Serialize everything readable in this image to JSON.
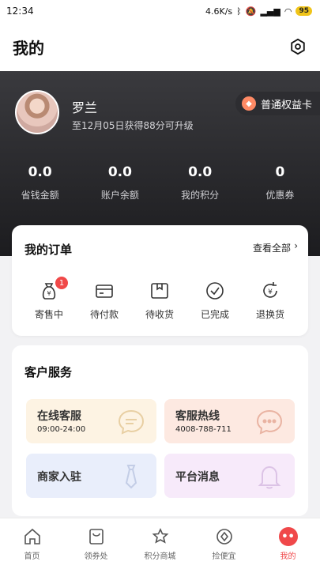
{
  "status_bar": {
    "time": "12:34",
    "network_speed": "4.6K/s",
    "signal_icons": [
      "bluetooth-icon",
      "mute-icon",
      "signal-icon",
      "wifi-icon"
    ],
    "battery": "95"
  },
  "header": {
    "title": "我的",
    "settings_icon": "gear-icon"
  },
  "profile": {
    "name": "罗兰",
    "upgrade_tip": "至12月05日获得88分可升级",
    "member_card": "普通权益卡"
  },
  "stats": [
    {
      "value": "0.0",
      "label": "省钱金额"
    },
    {
      "value": "0.0",
      "label": "账户余额"
    },
    {
      "value": "0.0",
      "label": "我的积分"
    },
    {
      "value": "0",
      "label": "优惠券"
    }
  ],
  "orders": {
    "title": "我的订单",
    "view_all": "查看全部",
    "items": [
      {
        "label": "寄售中",
        "icon": "money-bag-icon",
        "badge": "1"
      },
      {
        "label": "待付款",
        "icon": "wallet-icon"
      },
      {
        "label": "待收货",
        "icon": "package-icon"
      },
      {
        "label": "已完成",
        "icon": "check-circle-icon"
      },
      {
        "label": "退换货",
        "icon": "refund-icon"
      }
    ]
  },
  "services": {
    "title": "客户服务",
    "items": [
      {
        "name": "在线客服",
        "sub": "09:00-24:00",
        "icon": "chat-icon"
      },
      {
        "name": "客服热线",
        "sub": "4008-788-711",
        "icon": "chat-icon"
      },
      {
        "name": "商家入驻",
        "icon": "tie-icon"
      },
      {
        "name": "平台消息",
        "icon": "bell-icon"
      }
    ]
  },
  "tabs": [
    {
      "label": "首页",
      "icon": "home-icon"
    },
    {
      "label": "领券处",
      "icon": "coupon-bag-icon"
    },
    {
      "label": "积分商城",
      "icon": "points-mall-icon"
    },
    {
      "label": "捡便宜",
      "icon": "bargain-icon"
    },
    {
      "label": "我的",
      "icon": "me-icon",
      "active": true
    }
  ],
  "colors": {
    "accent": "#f0484a",
    "dark_bg": "#1c1c1f",
    "badge": "#f04848"
  }
}
